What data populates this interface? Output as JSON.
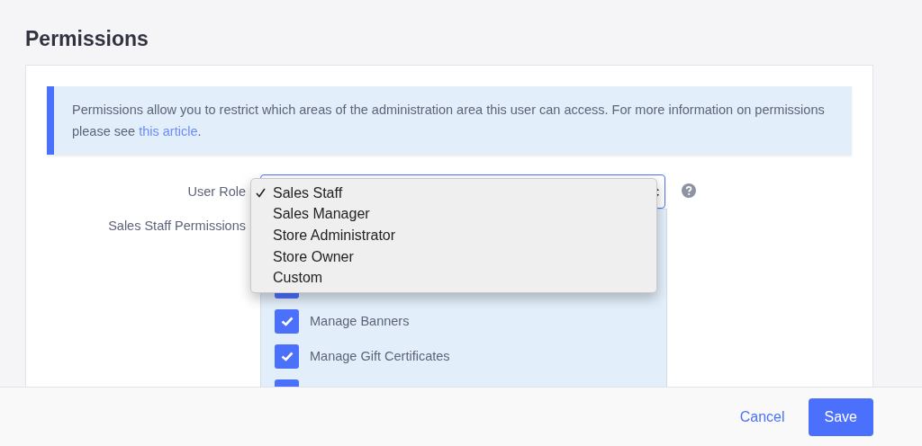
{
  "page": {
    "title": "Permissions"
  },
  "notice": {
    "text": "Permissions allow you to restrict which areas of the administration area this user can access. For more information on permissions please see ",
    "link": "this article",
    "end": "."
  },
  "user_role": {
    "label": "User Role",
    "options": [
      {
        "label": "Sales Staff",
        "selected": true
      },
      {
        "label": "Sales Manager",
        "selected": false
      },
      {
        "label": "Store Administrator",
        "selected": false
      },
      {
        "label": "Store Owner",
        "selected": false
      },
      {
        "label": "Custom",
        "selected": false
      }
    ]
  },
  "permissions": {
    "label": "Sales Staff Permissions",
    "items": [
      {
        "checked": true
      },
      {
        "label": "Manage Banners",
        "checked": true
      },
      {
        "label": "Manage Gift Certificates",
        "checked": true
      },
      {
        "checked": true
      }
    ]
  },
  "footer": {
    "cancel": "Cancel",
    "save": "Save"
  }
}
